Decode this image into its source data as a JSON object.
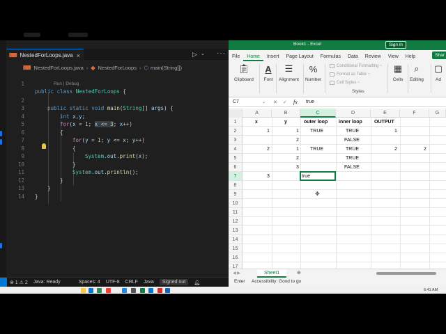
{
  "vscode": {
    "tab_label": "NestedForLoops.java",
    "breadcrumb": [
      "NestedForLoops.java",
      "NestedForLoops",
      "main(String[])"
    ],
    "codelens": "Run | Debug",
    "line_numbers": [
      "1",
      "2",
      "3",
      "4",
      "5",
      "6",
      "7",
      "8",
      "9",
      "10",
      "11",
      "12",
      "13",
      "14"
    ],
    "status": {
      "problems": "⊗ 1 ⚠ 2",
      "java_ready": "Java: Ready",
      "spaces": "Spaces: 4",
      "encoding": "UTF-8",
      "eol": "CRLF",
      "language": "Java",
      "signed_out": "Signed out"
    }
  },
  "excel": {
    "title": "Book1 - Excel",
    "sign_in": "Sign in",
    "tabs": [
      "File",
      "Home",
      "Insert",
      "Page Layout",
      "Formulas",
      "Data",
      "Review",
      "View",
      "Help"
    ],
    "active_tab": "Home",
    "share": "Shar",
    "ribbon": {
      "clipboard": "Clipboard",
      "font": "Font",
      "alignment": "Alignment",
      "number": "Number",
      "conditional": "Conditional Formatting ~",
      "format_table": "Format as Table ~",
      "cell_styles": "Cell Styles ~",
      "styles": "Styles",
      "cells": "Cells",
      "editing": "Editing",
      "adjacent": "Ad"
    },
    "name_box": "C7",
    "formula_value": "true",
    "columns": [
      "A",
      "B",
      "C",
      "D",
      "E",
      "F",
      "G"
    ],
    "rows": [
      "1",
      "2",
      "3",
      "4",
      "5",
      "6",
      "7",
      "8",
      "9",
      "10",
      "11",
      "12",
      "13",
      "14",
      "15",
      "16",
      "17"
    ],
    "cells": {
      "A1": "x",
      "B1": "y",
      "C1": "outer loop",
      "D1": "inner loop",
      "E1": "OUTPUT",
      "B2": "1",
      "A2": "1",
      "C2": "TRUE",
      "D2": "TRUE",
      "E2": "1",
      "B3": "2",
      "D3": "FALSE",
      "A4": "2",
      "B4": "1",
      "C4": "TRUE",
      "D4": "TRUE",
      "E4": "2",
      "F4": "2",
      "B5": "2",
      "D5": "TRUE",
      "B6": "3",
      "D6": "FALSE",
      "A7": "3",
      "C7": "true"
    },
    "sheet_tab": "Sheet1",
    "status_ready": "Enter",
    "accessibility": "Accessibility: Good to go"
  },
  "taskbar": {
    "time": "6:41 AM"
  },
  "colors": {
    "excel_green": "#107c41",
    "vscode_bg": "#1f1f1f",
    "vscode_blue": "#0078d4"
  }
}
